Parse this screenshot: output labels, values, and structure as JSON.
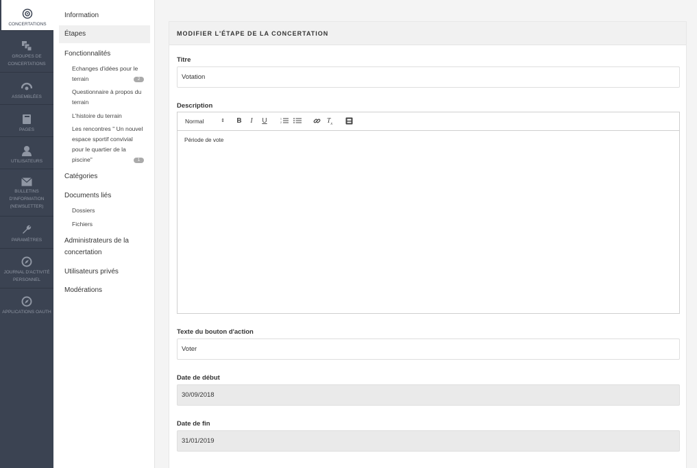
{
  "main_nav": [
    {
      "label": "Concertations",
      "icon": "target-icon",
      "active": true
    },
    {
      "label": "Groupes de concertations",
      "icon": "stack-icon"
    },
    {
      "label": "Assemblées",
      "icon": "eye-icon"
    },
    {
      "label": "Pages",
      "icon": "book-icon"
    },
    {
      "label": "Utilisateurs",
      "icon": "user-icon"
    },
    {
      "label": "Bulletins d'information (newsletter)",
      "icon": "envelope-icon"
    },
    {
      "label": "Paramètres",
      "icon": "wrench-icon"
    },
    {
      "label": "Journal d'activité personnel",
      "icon": "compass-icon"
    },
    {
      "label": "Applications OAuth",
      "icon": "compass-icon"
    }
  ],
  "sub_nav": {
    "information": "Information",
    "etapes": "Étapes",
    "fonctionnalites": "Fonctionnalités",
    "features": [
      {
        "label": "Echanges d'idées pour le terrain",
        "badge": "2"
      },
      {
        "label": "Questionnaire à propos du terrain",
        "badge": ""
      },
      {
        "label": "L'histoire du terrain",
        "badge": ""
      },
      {
        "label": "Les rencontres \" Un nouvel espace sportif convivial pour le quartier de la piscine\"",
        "badge": "1"
      }
    ],
    "categories": "Catégories",
    "documents": "Documents liés",
    "dossiers": "Dossiers",
    "fichiers": "Fichiers",
    "admins": "Administrateurs de la concertation",
    "private_users": "Utilisateurs privés",
    "moderations": "Modérations"
  },
  "form": {
    "header": "MODIFIER L'ÉTAPE DE LA CONCERTATION",
    "title_label": "Titre",
    "title_value": "Votation",
    "description_label": "Description",
    "editor_format": "Normal",
    "description_value": "Période de vote",
    "action_label": "Texte du bouton d'action",
    "action_value": "Voter",
    "start_label": "Date de début",
    "start_value": "30/09/2018",
    "end_label": "Date de fin",
    "end_value": "31/01/2019"
  },
  "colors": {
    "nav_bg": "#3b4352",
    "page_bg": "#f4f4f4"
  }
}
